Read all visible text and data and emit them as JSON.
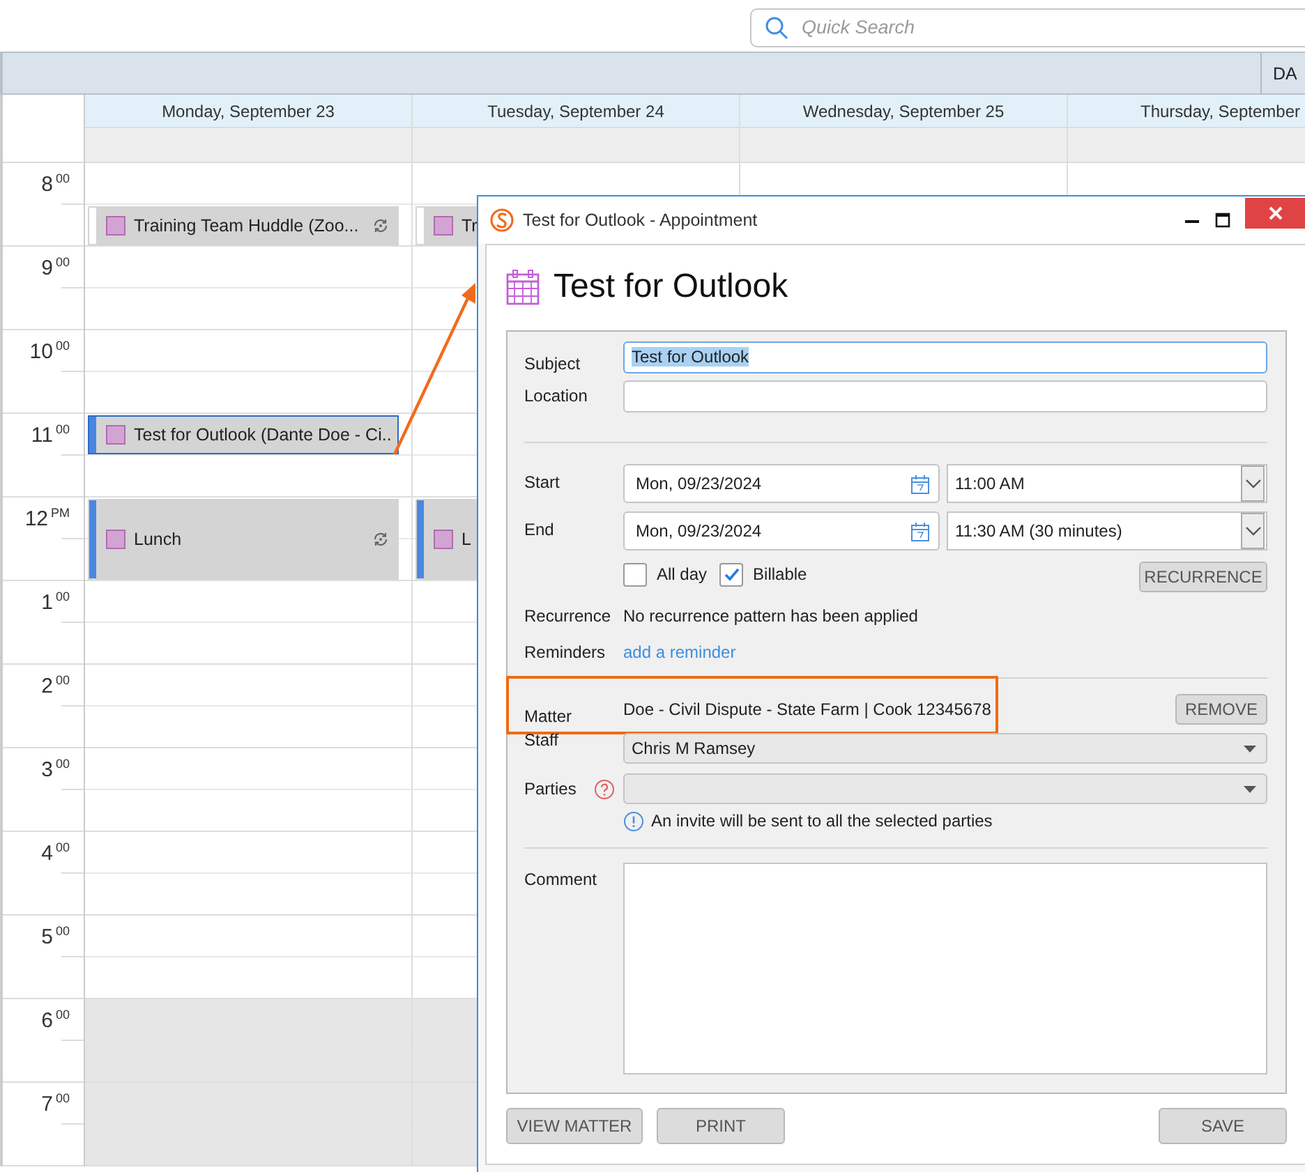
{
  "search": {
    "placeholder": "Quick Search"
  },
  "view_tab": {
    "label": "DA"
  },
  "hours": [
    {
      "hour": "8",
      "suffix": "00",
      "after_hours": false
    },
    {
      "hour": "9",
      "suffix": "00",
      "after_hours": false
    },
    {
      "hour": "10",
      "suffix": "00",
      "after_hours": false
    },
    {
      "hour": "11",
      "suffix": "00",
      "after_hours": false
    },
    {
      "hour": "12",
      "suffix": "PM",
      "after_hours": false
    },
    {
      "hour": "1",
      "suffix": "00",
      "after_hours": false
    },
    {
      "hour": "2",
      "suffix": "00",
      "after_hours": false
    },
    {
      "hour": "3",
      "suffix": "00",
      "after_hours": false
    },
    {
      "hour": "4",
      "suffix": "00",
      "after_hours": false
    },
    {
      "hour": "5",
      "suffix": "00",
      "after_hours": false
    },
    {
      "hour": "6",
      "suffix": "00",
      "after_hours": true
    },
    {
      "hour": "7",
      "suffix": "00",
      "after_hours": true
    }
  ],
  "days": [
    {
      "label": "Monday, September 23",
      "events": [
        {
          "title": "Training Team Huddle  (Zoo...",
          "kind": "half",
          "recurring": true,
          "accent": false,
          "selected": false
        },
        {
          "title": "Test for Outlook (Dante Doe - Ci..",
          "kind": "half",
          "recurring": false,
          "accent": true,
          "selected": true
        },
        {
          "title": "Lunch",
          "kind": "hour",
          "recurring": true,
          "accent": true,
          "selected": false
        }
      ]
    },
    {
      "label": "Tuesday, September 24",
      "events": [
        {
          "title": "Tr",
          "kind": "half",
          "recurring": false,
          "accent": false,
          "selected": false
        },
        {
          "title": "L",
          "kind": "hour",
          "recurring": false,
          "accent": true,
          "selected": false
        }
      ]
    },
    {
      "label": "Wednesday, September 25"
    },
    {
      "label": "Thursday, September"
    }
  ],
  "callout_arrow": true,
  "dialog": {
    "title": "Test for Outlook - Appointment",
    "heading": "Test for Outlook",
    "subject": {
      "label": "Subject",
      "value": "Test for Outlook",
      "selected": true
    },
    "location": {
      "label": "Location"
    },
    "start": {
      "label": "Start",
      "date": "Mon, 09/23/2024",
      "time": "11:00 AM"
    },
    "end": {
      "label": "End",
      "date": "Mon, 09/23/2024",
      "time": "11:30 AM (30 minutes)"
    },
    "checkboxes": [
      {
        "label": "All day",
        "checked": false
      },
      {
        "label": "Billable",
        "checked": true
      }
    ],
    "recurrence_button": "RECURRENCE",
    "recurrence": {
      "label": "Recurrence",
      "value": "No recurrence pattern has been applied"
    },
    "reminders": {
      "label": "Reminders",
      "link": "add a reminder"
    },
    "matter": {
      "label": "Matter",
      "value": "Doe - Civil Dispute - State Farm | Cook 12345678",
      "highlighted": true,
      "button": "REMOVE"
    },
    "staff": {
      "label": "Staff",
      "value": "Chris M Ramsey"
    },
    "parties": {
      "label": "Parties"
    },
    "info": "An invite will be sent to all the selected parties",
    "comment": {
      "label": "Comment"
    },
    "left_buttons": [
      "VIEW MATTER",
      "PRINT"
    ],
    "right_buttons": [
      "SAVE"
    ]
  }
}
